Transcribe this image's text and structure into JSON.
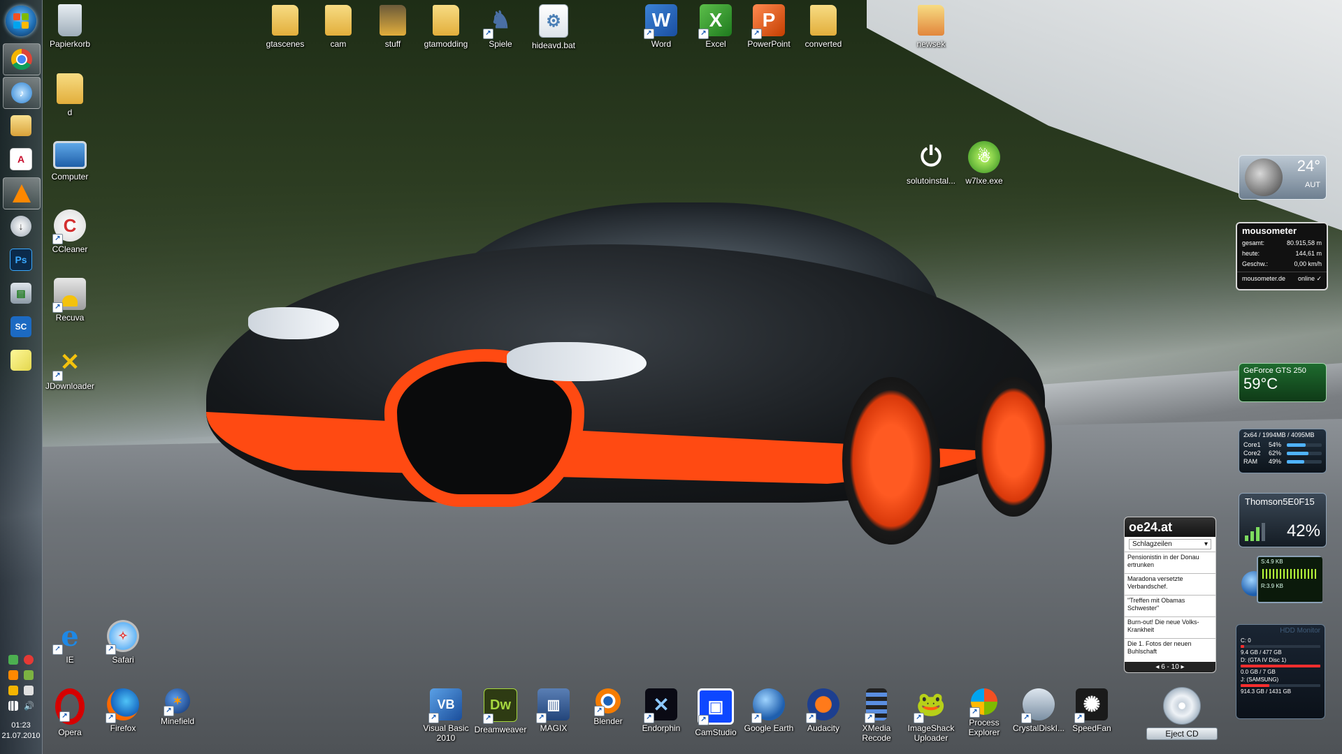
{
  "desktop_icons": {
    "papierkorb": "Papierkorb",
    "d": "d",
    "computer": "Computer",
    "ccleaner": "CCleaner",
    "recuva": "Recuva",
    "jdownloader": "JDownloader",
    "ie": "IE",
    "safari": "Safari",
    "opera": "Opera",
    "firefox": "Firefox",
    "minefield": "Minefield",
    "gtascenes": "gtascenes",
    "cam": "cam",
    "stuff": "stuff",
    "gtamodding": "gtamodding",
    "spiele": "Spiele",
    "hideavd": "hideavd.bat",
    "word": "Word",
    "excel": "Excel",
    "powerpoint": "PowerPoint",
    "converted": "converted",
    "newsek": "newsek",
    "solutoinstal": "solutoinstal...",
    "w7lxe": "w7lxe.exe",
    "visual_basic": "Visual Basic 2010",
    "dreamweaver": "Dreamweaver",
    "magix": "MAGIX",
    "blender": "Blender",
    "endorphin": "Endorphin",
    "camstudio": "CamStudio",
    "google_earth": "Google Earth",
    "audacity": "Audacity",
    "xmedia": "XMedia Recode",
    "imageshack": "ImageShack Uploader",
    "process_explorer": "Process Explorer",
    "crystaldisk": "CrystalDiskI...",
    "speedfan": "SpeedFan"
  },
  "taskbar": {
    "pinned_icons": [
      "chrome-icon",
      "itunes-icon",
      "explorer-icon",
      "acrobat-icon",
      "vlc-icon",
      "download-icon",
      "photoshop-icon",
      "task-manager-icon",
      "snapshot-icon",
      "sticky-notes-icon"
    ],
    "ps_label": "Ps",
    "sc_label": "SC",
    "clock_time": "01:23",
    "clock_date": "21.07.2010"
  },
  "gadgets": {
    "weather": {
      "temp": "24°",
      "location": "AUT"
    },
    "mousometer": {
      "title": "mousometer",
      "rows": [
        {
          "k": "gesamt:",
          "v": "80.915,58 m"
        },
        {
          "k": "heute:",
          "v": "144,61 m"
        },
        {
          "k": "Geschw.:",
          "v": "0,00 km/h"
        }
      ],
      "footer_left": "mousometer.de",
      "footer_right": "online ✓"
    },
    "gpu": {
      "name": "GeForce GTS 250",
      "temp": "59°C"
    },
    "cpu": {
      "header": "2x64 / 1994MB / 4095MB",
      "rows": [
        {
          "k": "Core1",
          "v": "54%",
          "pct": 54
        },
        {
          "k": "Core2",
          "v": "62%",
          "pct": 62
        },
        {
          "k": "RAM",
          "v": "49%",
          "pct": 49
        }
      ]
    },
    "wifi": {
      "ssid": "Thomson5E0F15",
      "signal": "42%"
    },
    "network": {
      "send": "S:4.9 KB",
      "recv": "R:3.9 KB"
    },
    "hdd": {
      "title": "HDD Monitor",
      "drives": [
        {
          "name": "C: 0",
          "info": "9.4 GB / 477 GB",
          "fill": 0.02
        },
        {
          "name": "D: (GTA IV Disc 1)",
          "info": "0.0 GB / 7 GB",
          "fill": 1.0
        },
        {
          "name": "J: (SAMSUNG)",
          "info": "914.3 GB / 1431 GB",
          "fill": 0.36
        }
      ]
    },
    "news": {
      "logo": "oe24.at",
      "dropdown": "Schlagzeilen",
      "items": [
        "Pensionistin in der Donau ertrunken",
        "Maradona versetzte Verbandschef.",
        "\"Treffen mit Obamas Schwester\"",
        "Burn-out! Die neue Volks-Krankheit",
        "Die 1. Fotos der neuen Buhlschaft"
      ],
      "pager": "6 - 10"
    },
    "eject": {
      "label": "Eject CD"
    }
  }
}
